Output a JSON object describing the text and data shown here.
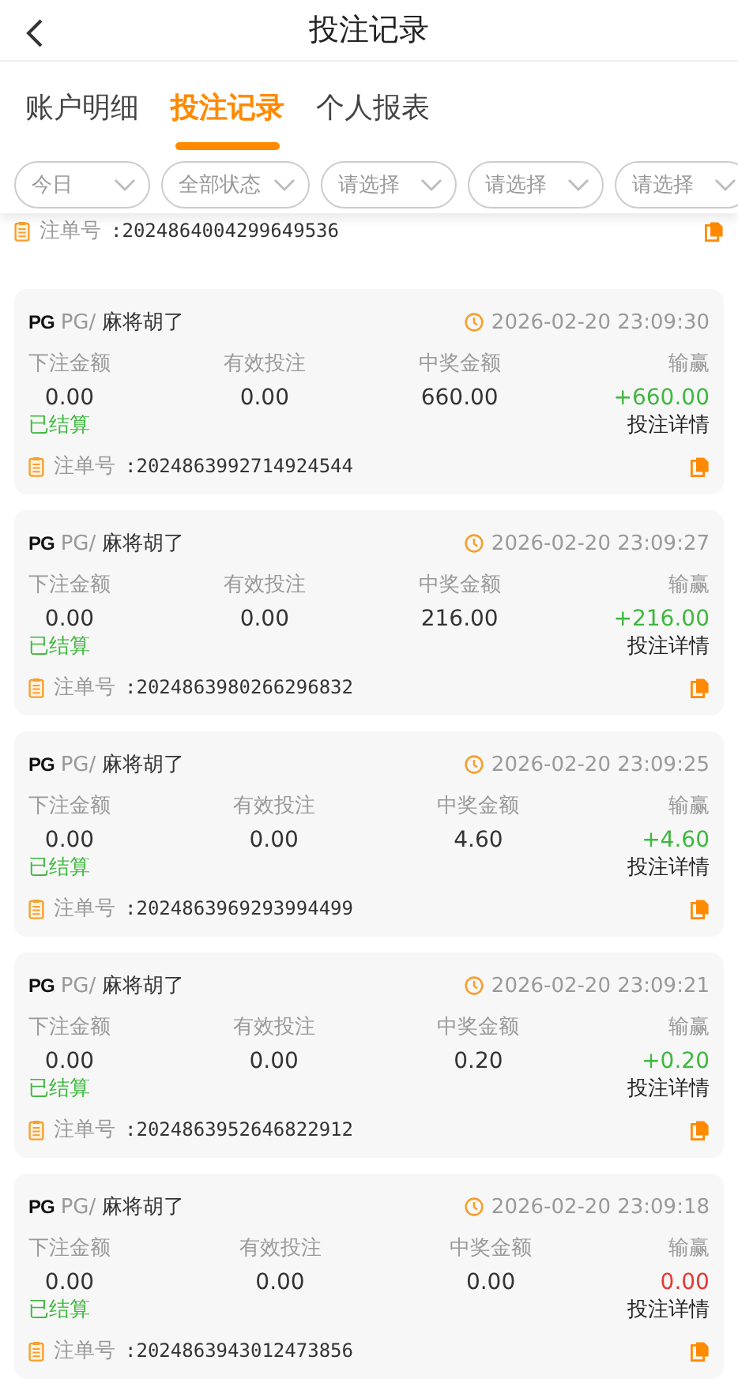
{
  "header": {
    "title": "投注记录"
  },
  "tabs": [
    {
      "label": "账户明细",
      "selected": false
    },
    {
      "label": "投注记录",
      "selected": true
    },
    {
      "label": "个人报表",
      "selected": false
    }
  ],
  "filters": [
    "今日",
    "全部状态",
    "请选择",
    "请选择",
    "请选择"
  ],
  "partial_order": {
    "label": "注单号",
    "number": ":2024864004299649536"
  },
  "records": [
    {
      "logo": "PG",
      "provider": "PG/",
      "game": "麻将胡了",
      "time": "2026-02-20 23:09:30",
      "columns": [
        "下注金额",
        "有效投注",
        "中奖金额",
        "输赢"
      ],
      "bet": "0.00",
      "valid": "0.00",
      "payout": "660.00",
      "result": "+660.00",
      "color": "#3db83d",
      "status": "已结算",
      "detail": "投注详情",
      "order_label": "注单号",
      "order_no": ":2024863992714924544"
    },
    {
      "logo": "PG",
      "provider": "PG/",
      "game": "麻将胡了",
      "time": "2026-02-20 23:09:27",
      "columns": [
        "下注金额",
        "有效投注",
        "中奖金额",
        "输赢"
      ],
      "bet": "0.00",
      "valid": "0.00",
      "payout": "216.00",
      "result": "+216.00",
      "color": "#3db83d",
      "status": "已结算",
      "detail": "投注详情",
      "order_label": "注单号",
      "order_no": ":2024863980266296832"
    },
    {
      "logo": "PG",
      "provider": "PG/",
      "game": "麻将胡了",
      "time": "2026-02-20 23:09:25",
      "columns": [
        "下注金额",
        "有效投注",
        "中奖金额",
        "输赢"
      ],
      "bet": "0.00",
      "valid": "0.00",
      "payout": "4.60",
      "result": "+4.60",
      "color": "#3db83d",
      "status": "已结算",
      "detail": "投注详情",
      "order_label": "注单号",
      "order_no": ":2024863969293994499"
    },
    {
      "logo": "PG",
      "provider": "PG/",
      "game": "麻将胡了",
      "time": "2026-02-20 23:09:21",
      "columns": [
        "下注金额",
        "有效投注",
        "中奖金额",
        "输赢"
      ],
      "bet": "0.00",
      "valid": "0.00",
      "payout": "0.20",
      "result": "+0.20",
      "color": "#3db83d",
      "status": "已结算",
      "detail": "投注详情",
      "order_label": "注单号",
      "order_no": ":2024863952646822912"
    },
    {
      "logo": "PG",
      "provider": "PG/",
      "game": "麻将胡了",
      "time": "2026-02-20 23:09:18",
      "columns": [
        "下注金额",
        "有效投注",
        "中奖金额",
        "输赢"
      ],
      "bet": "0.00",
      "valid": "0.00",
      "payout": "0.00",
      "result": "0.00",
      "color": "#e53935",
      "status": "已结算",
      "detail": "投注详情",
      "order_label": "注单号",
      "order_no": ":2024863943012473856"
    }
  ]
}
